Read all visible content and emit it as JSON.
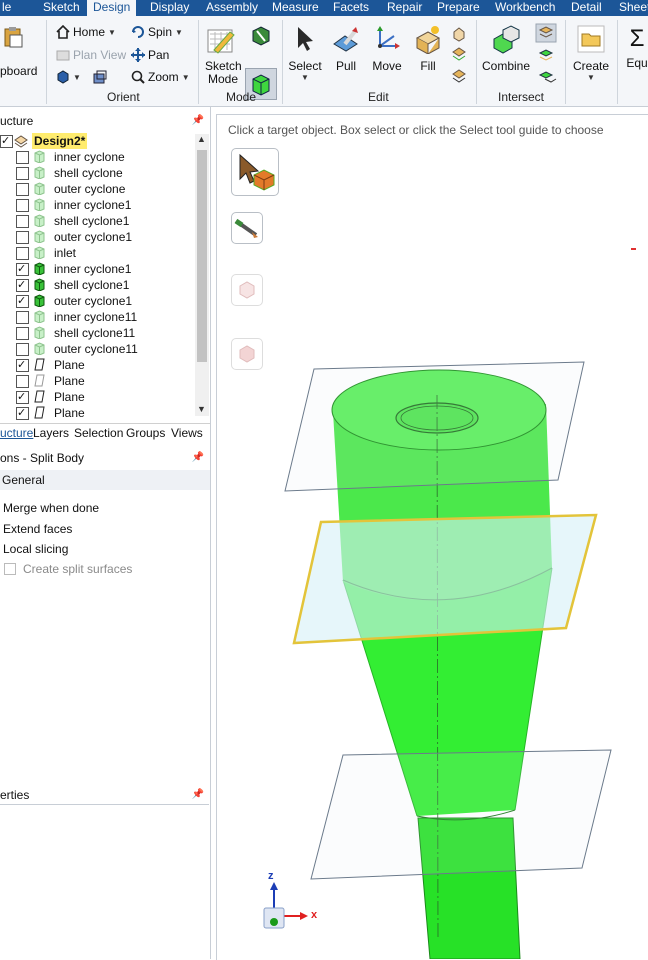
{
  "menu": {
    "tabs": [
      "le",
      "Sketch",
      "Design",
      "Display",
      "Assembly",
      "Measure",
      "Facets",
      "Repair",
      "Prepare",
      "Workbench",
      "Detail",
      "Sheet"
    ],
    "active": "Design"
  },
  "ribbon": {
    "clipboard_label": "pboard",
    "orient": {
      "home": "Home",
      "spin": "Spin",
      "plan_view": "Plan View",
      "pan": "Pan",
      "zoom": "Zoom",
      "label": "Orient"
    },
    "mode": {
      "sketch_mode_1": "Sketch",
      "sketch_mode_2": "Mode",
      "label": "Mode"
    },
    "edit": {
      "select": "Select",
      "pull": "Pull",
      "move": "Move",
      "fill": "Fill",
      "label": "Edit"
    },
    "intersect": {
      "combine": "Combine",
      "label": "Intersect"
    },
    "create": {
      "create": "Create"
    },
    "equation": "Equ"
  },
  "structure": {
    "header": "ucture",
    "root": "Design2*",
    "items": [
      {
        "label": "inner cyclone",
        "checked": false,
        "kind": "body-hidden"
      },
      {
        "label": "shell cyclone",
        "checked": false,
        "kind": "body-hidden"
      },
      {
        "label": "outer cyclone",
        "checked": false,
        "kind": "body-hidden"
      },
      {
        "label": "inner cyclone1",
        "checked": false,
        "kind": "body-hidden"
      },
      {
        "label": "shell cyclone1",
        "checked": false,
        "kind": "body-hidden"
      },
      {
        "label": "outer cyclone1",
        "checked": false,
        "kind": "body-hidden"
      },
      {
        "label": "inlet",
        "checked": false,
        "kind": "body-hidden"
      },
      {
        "label": "inner cyclone1",
        "checked": true,
        "kind": "body"
      },
      {
        "label": "shell cyclone1",
        "checked": true,
        "kind": "body"
      },
      {
        "label": "outer cyclone1",
        "checked": true,
        "kind": "body"
      },
      {
        "label": "inner cyclone11",
        "checked": false,
        "kind": "body-hidden"
      },
      {
        "label": "shell cyclone11",
        "checked": false,
        "kind": "body-hidden"
      },
      {
        "label": "outer cyclone11",
        "checked": false,
        "kind": "body-hidden"
      },
      {
        "label": "Plane",
        "checked": true,
        "kind": "plane"
      },
      {
        "label": "Plane",
        "checked": false,
        "kind": "plane"
      },
      {
        "label": "Plane",
        "checked": true,
        "kind": "plane"
      },
      {
        "label": "Plane",
        "checked": true,
        "kind": "plane"
      }
    ],
    "tabs": [
      "ucture",
      "Layers",
      "Selection",
      "Groups",
      "Views"
    ]
  },
  "options": {
    "header": "ons - Split Body",
    "general": "General",
    "merge": "Merge when done",
    "extend": "Extend faces",
    "local": "Local slicing",
    "create_split": "Create split surfaces"
  },
  "properties": {
    "header": "erties"
  },
  "viewport": {
    "hint": "Click a target object.  Box select or click the Select tool guide to choose",
    "axis_z": "z",
    "axis_x": "x"
  },
  "colors": {
    "menubar": "#1c5698",
    "body_green": "#33ee33",
    "plane_highlight": "#e3c43a"
  }
}
